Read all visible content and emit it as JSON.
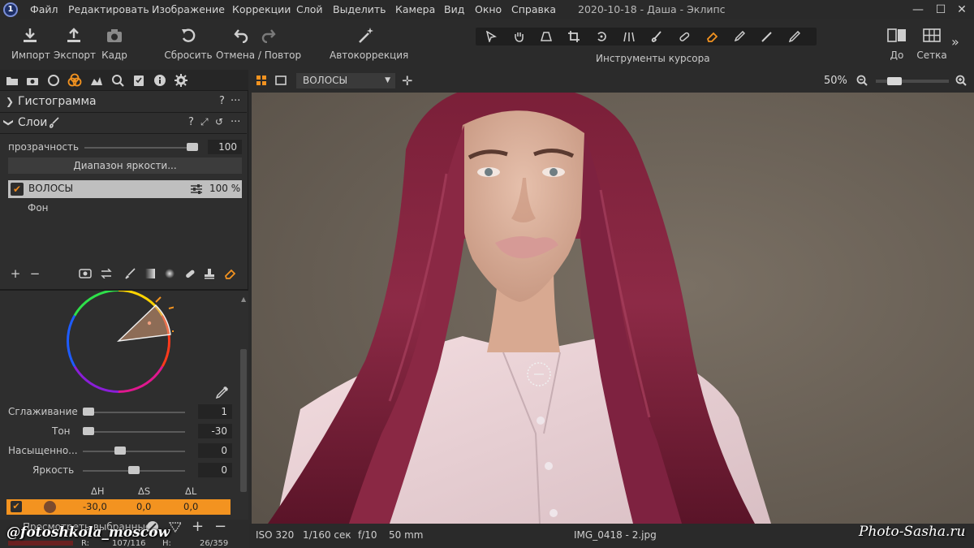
{
  "menu": {
    "items": [
      "Файл",
      "Редактировать",
      "Изображение",
      "Коррекции",
      "Слой",
      "Выделить",
      "Камера",
      "Вид",
      "Окно",
      "Справка"
    ],
    "window_title": "2020-10-18 - Даша - Эклипс"
  },
  "toolbar": {
    "import": "Импорт",
    "export": "Экспорт",
    "capture": "Кадр",
    "reset": "Сбросить",
    "undo_redo": "Отмена / Повтор",
    "auto_adjust": "Автокоррекция",
    "cursor_tools": "Инструменты курсора",
    "before": "До",
    "grid": "Сетка"
  },
  "histogram": {
    "title": "Гистограмма",
    "help": "?",
    "more": "···"
  },
  "layers": {
    "title": "Слои",
    "help": "?",
    "more": "···",
    "opacity_label": "прозрачность",
    "opacity_value": "100",
    "opacity": 1.0,
    "luma_range_button": "Диапазон яркости...",
    "items": [
      {
        "name": "ВОЛОСЫ",
        "opacity": "100 %",
        "checked": true,
        "selected": true
      },
      {
        "name": "Фон"
      }
    ],
    "add": "+",
    "remove": "−"
  },
  "color_editor": {
    "sliders": [
      {
        "label": "Сглаживание",
        "value": "1",
        "position": 0.0
      },
      {
        "label": "Тон",
        "value": "-30",
        "position": 0.0
      },
      {
        "label": "Насыщенно...",
        "value": "0",
        "position": 0.35
      },
      {
        "label": "Яркость",
        "value": "0",
        "position": 0.5
      }
    ],
    "table": {
      "headers": [
        "ΔH",
        "ΔS",
        "ΔL"
      ],
      "row": {
        "checked": true,
        "swatch_color": "#7a4a2e",
        "dh": "-30,0",
        "ds": "0,0",
        "dl": "0,0"
      }
    },
    "view_selected_colors": "Просмотреть выбранные",
    "add": "+",
    "remove": "−",
    "readout_rgb": "R:",
    "readout_rgb_value": "107/116",
    "readout_h": "H:",
    "readout_h_value": "26/359"
  },
  "viewer": {
    "layer_select": "ВОЛОСЫ",
    "zoom": "50%",
    "zoom_slider": 0.2
  },
  "status": {
    "iso": "ISO 320",
    "shutter": "1/160 сек",
    "aperture": "f/10",
    "focal": "50 mm",
    "filename": "IMG_0418 - 2.jpg"
  },
  "watermarks": {
    "left": "@fotoshkola_moscow",
    "right": "Photo-Sasha.ru"
  },
  "colors": {
    "accent": "#f39320",
    "panel": "#2e2e2e",
    "background": "#2b2b2b"
  },
  "icons": {
    "import": "download-icon",
    "export": "upload-icon",
    "capture": "camera-icon",
    "reset": "reset-icon",
    "undo": "undo-icon",
    "redo": "redo-icon",
    "auto": "magic-wand-icon"
  }
}
